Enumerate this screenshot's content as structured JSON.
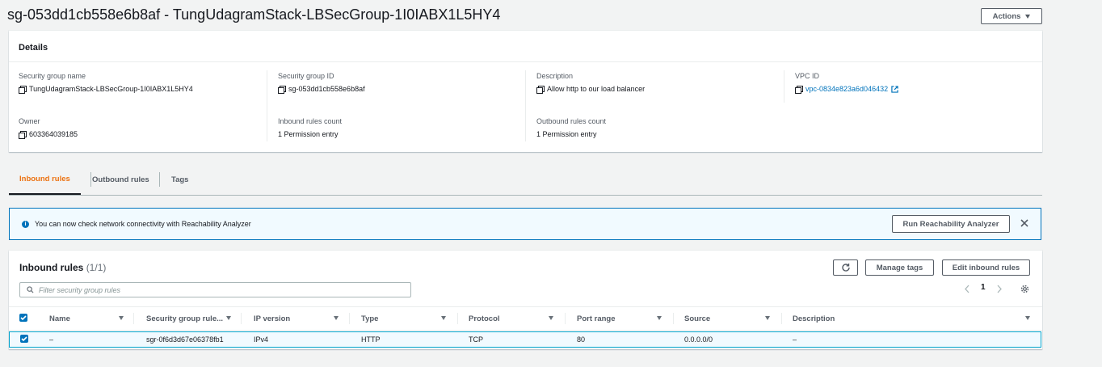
{
  "header": {
    "title": "sg-053dd1cb558e6b8af - TungUdagramStack-LBSecGroup-1I0IABX1L5HY4",
    "actions_label": "Actions"
  },
  "details": {
    "heading": "Details",
    "fields": {
      "sg_name": {
        "label": "Security group name",
        "value": "TungUdagramStack-LBSecGroup-1I0IABX1L5HY4"
      },
      "sg_id": {
        "label": "Security group ID",
        "value": "sg-053dd1cb558e6b8af"
      },
      "description": {
        "label": "Description",
        "value": "Allow http to our load balancer"
      },
      "vpc_id": {
        "label": "VPC ID",
        "value": "vpc-0834e823a6d046432"
      },
      "owner": {
        "label": "Owner",
        "value": "603364039185"
      },
      "inbound_count": {
        "label": "Inbound rules count",
        "value": "1 Permission entry"
      },
      "outbound_count": {
        "label": "Outbound rules count",
        "value": "1 Permission entry"
      }
    }
  },
  "tabs": [
    {
      "label": "Inbound rules",
      "active": true
    },
    {
      "label": "Outbound rules",
      "active": false
    },
    {
      "label": "Tags",
      "active": false
    }
  ],
  "alert": {
    "message": "You can now check network connectivity with Reachability Analyzer",
    "button_label": "Run Reachability Analyzer"
  },
  "inbound": {
    "title": "Inbound rules",
    "count": "(1/1)",
    "manage_tags_label": "Manage tags",
    "edit_label": "Edit inbound rules",
    "search_placeholder": "Filter security group rules",
    "page": "1",
    "columns": [
      "Name",
      "Security group rule...",
      "IP version",
      "Type",
      "Protocol",
      "Port range",
      "Source",
      "Description"
    ],
    "rows": [
      {
        "name": "–",
        "rule_id": "sgr-0f6d3d67e06378fb1",
        "ip_version": "IPv4",
        "type": "HTTP",
        "protocol": "TCP",
        "port_range": "80",
        "source": "0.0.0.0/0",
        "description": "–"
      }
    ]
  },
  "colors": {
    "accent": "#ec7211",
    "link": "#0073bb",
    "selected_row_bg": "#f1faff"
  }
}
